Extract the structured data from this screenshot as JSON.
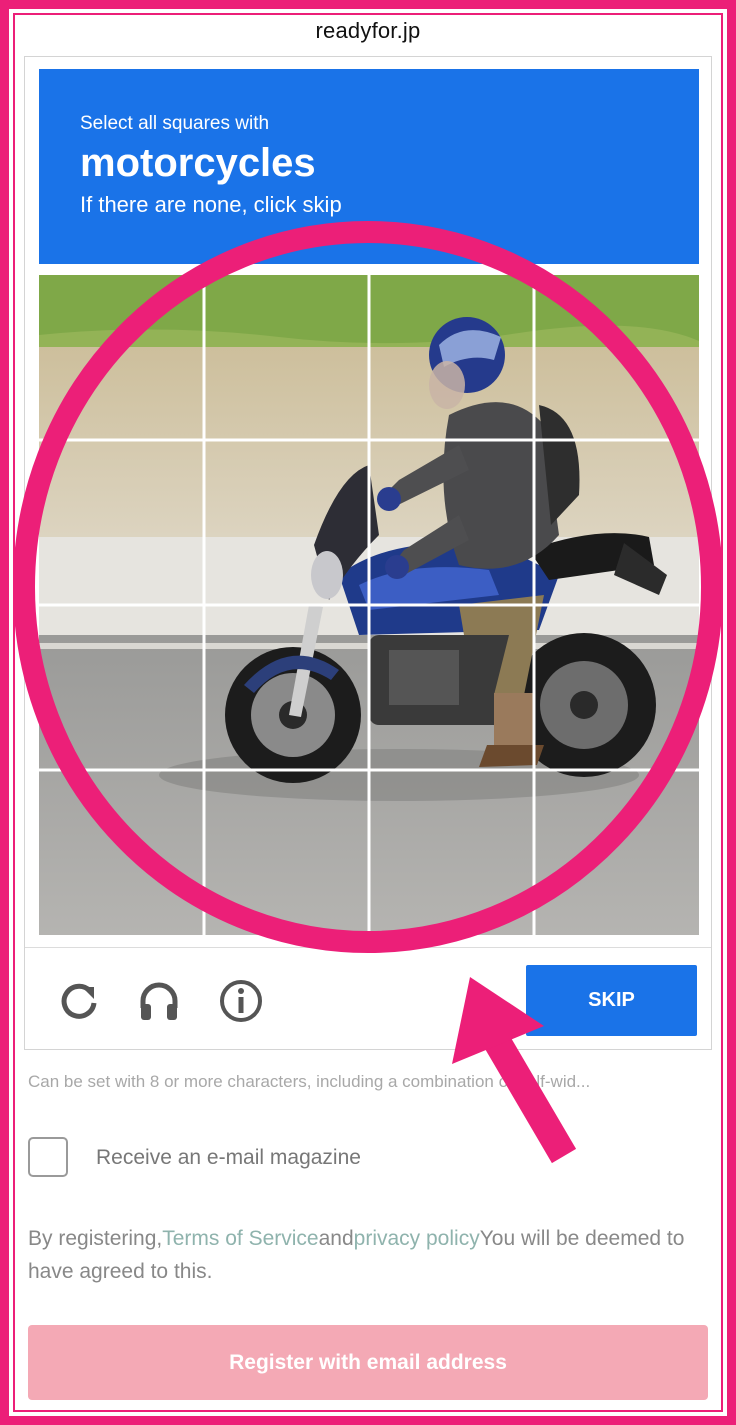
{
  "browser": {
    "url": "readyfor.jp"
  },
  "captcha": {
    "instruction_line1": "Select all squares with",
    "target_object": "motorcycles",
    "instruction_line3": "If there are none, click skip",
    "grid_rows": 4,
    "grid_cols": 4,
    "skip_label": "SKIP",
    "icons": [
      "reload-icon",
      "headphones-icon",
      "info-icon"
    ],
    "header_color": "#1a73e8"
  },
  "form": {
    "password_hint": "Can be set with 8 or more characters, including a combination of half-wid...",
    "newsletter_label": "Receive an e-mail magazine",
    "newsletter_checked": false,
    "terms_prefix": "By registering,",
    "terms_link": "Terms of Service",
    "terms_and": "and",
    "privacy_link": "privacy policy",
    "terms_suffix": "You will be deemed to have agreed to this.",
    "register_label": "Register with email address",
    "register_color": "#f4a9b5"
  },
  "annotation": {
    "color": "#ec1f78"
  }
}
